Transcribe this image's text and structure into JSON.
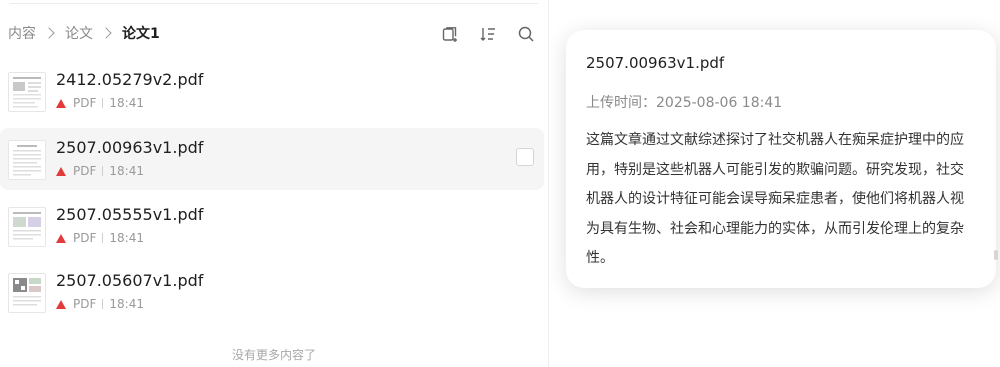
{
  "breadcrumb": {
    "items": [
      "内容",
      "论文",
      "论文1"
    ]
  },
  "toolbar": {
    "icons": [
      "new-folder-icon",
      "sort-icon",
      "search-icon"
    ]
  },
  "files": [
    {
      "name": "2412.05279v2.pdf",
      "type": "PDF",
      "time": "18:41"
    },
    {
      "name": "2507.00963v1.pdf",
      "type": "PDF",
      "time": "18:41"
    },
    {
      "name": "2507.05555v1.pdf",
      "type": "PDF",
      "time": "18:41"
    },
    {
      "name": "2507.05607v1.pdf",
      "type": "PDF",
      "time": "18:41"
    }
  ],
  "empty_note": "没有更多内容了",
  "popover": {
    "title": "2507.00963v1.pdf",
    "upload_time": "上传时间：2025-08-06 18:41",
    "summary": "这篇文章通过文献综述探讨了社交机器人在痴呆症护理中的应用，特别是这些机器人可能引发的欺骗问题。研究发现，社交机器人的设计特征可能会误导痴呆症患者，使他们将机器人视为具有生物、社会和心理能力的实体，从而引发伦理上的复杂性。"
  },
  "colors": {
    "pdf_accent": "#e23b3b",
    "hover_bg": "#f5f5f5"
  }
}
